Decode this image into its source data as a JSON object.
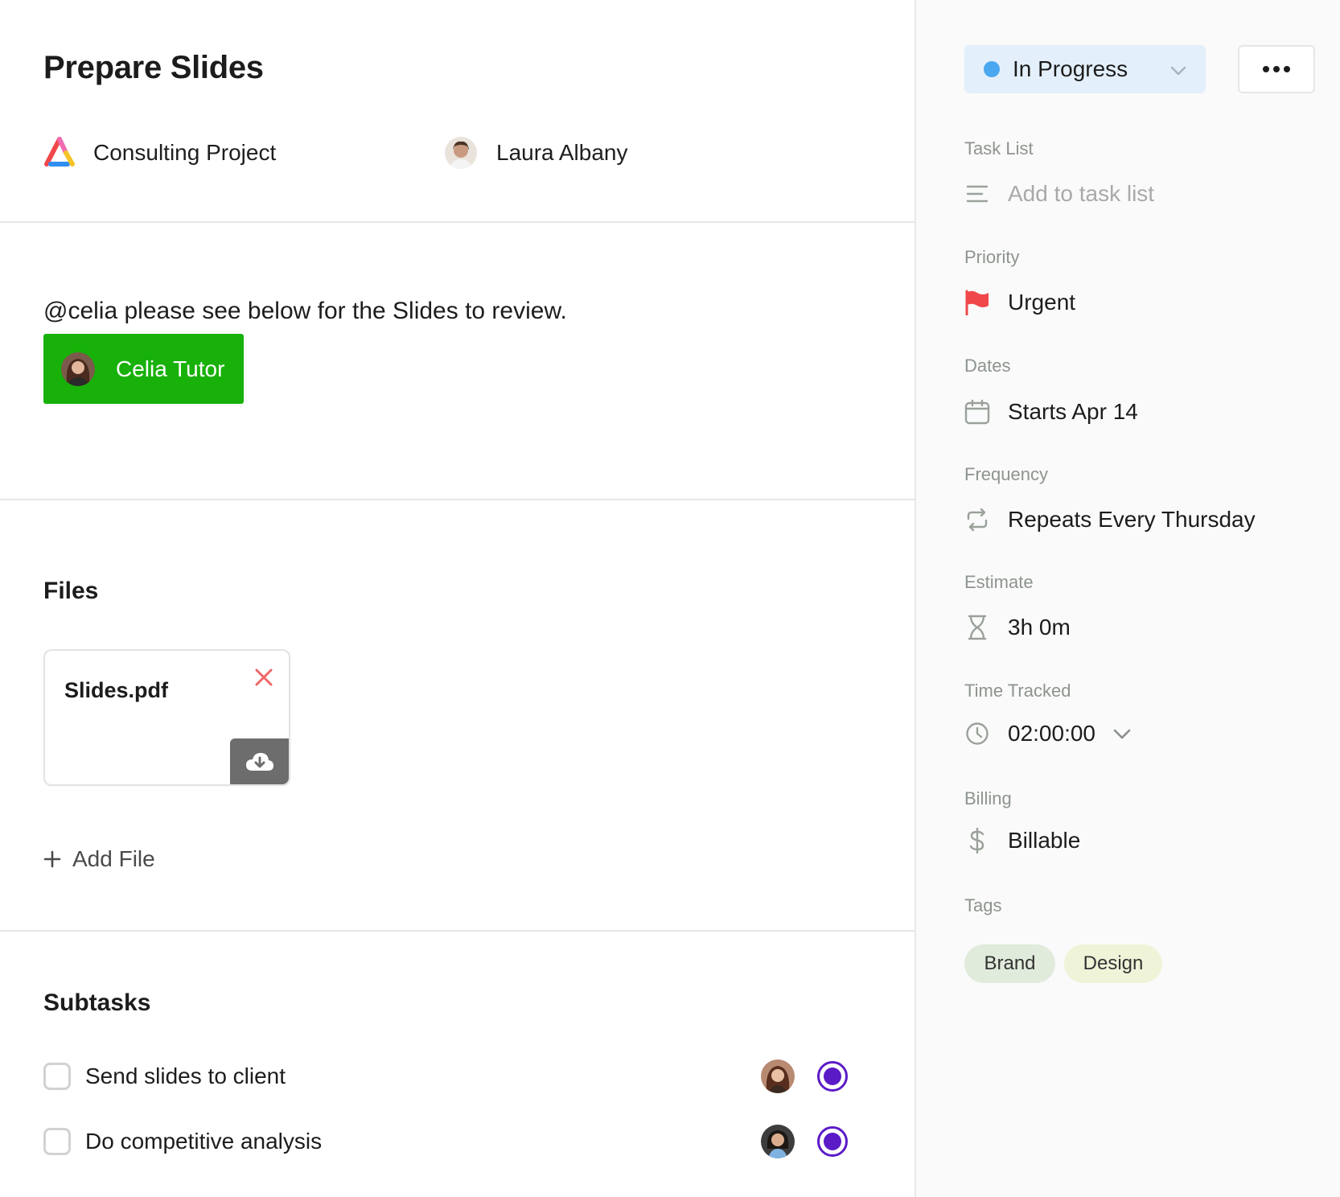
{
  "task": {
    "title": "Prepare Slides",
    "project": "Consulting Project",
    "assignee": "Laura Albany"
  },
  "comment": {
    "text": "@celia please see below for the Slides to review.",
    "mention_name": "Celia Tutor",
    "mention_color": "#18b10a"
  },
  "files": {
    "heading": "Files",
    "items": [
      {
        "name": "Slides.pdf"
      }
    ],
    "add_label": "Add File"
  },
  "subtasks": {
    "heading": "Subtasks",
    "items": [
      {
        "label": "Send slides to client"
      },
      {
        "label": "Do competitive analysis"
      }
    ]
  },
  "sidebar": {
    "status": {
      "label": "In Progress",
      "dot_color": "#4aa8f0"
    },
    "task_list": {
      "label": "Task List",
      "placeholder": "Add to task list"
    },
    "priority": {
      "label": "Priority",
      "value": "Urgent",
      "flag_color": "#f0474a"
    },
    "dates": {
      "label": "Dates",
      "value": "Starts Apr 14"
    },
    "frequency": {
      "label": "Frequency",
      "value": "Repeats Every Thursday"
    },
    "estimate": {
      "label": "Estimate",
      "value": "3h 0m"
    },
    "time_tracked": {
      "label": "Time Tracked",
      "value": "02:00:00"
    },
    "billing": {
      "label": "Billing",
      "value": "Billable"
    },
    "tags": {
      "label": "Tags",
      "items": [
        "Brand",
        "Design"
      ]
    }
  },
  "colors": {
    "accent_purple": "#5b1bc7",
    "label_gray": "#8d948d"
  },
  "icons": {
    "project": "project-logo-icon",
    "download": "cloud-download-icon",
    "remove": "close-icon",
    "add": "plus-icon",
    "task_list": "list-icon",
    "priority": "flag-icon",
    "dates": "calendar-icon",
    "frequency": "repeat-icon",
    "estimate": "hourglass-icon",
    "time_tracked": "clock-icon",
    "billing": "dollar-icon",
    "more": "more-horizontal-icon"
  }
}
